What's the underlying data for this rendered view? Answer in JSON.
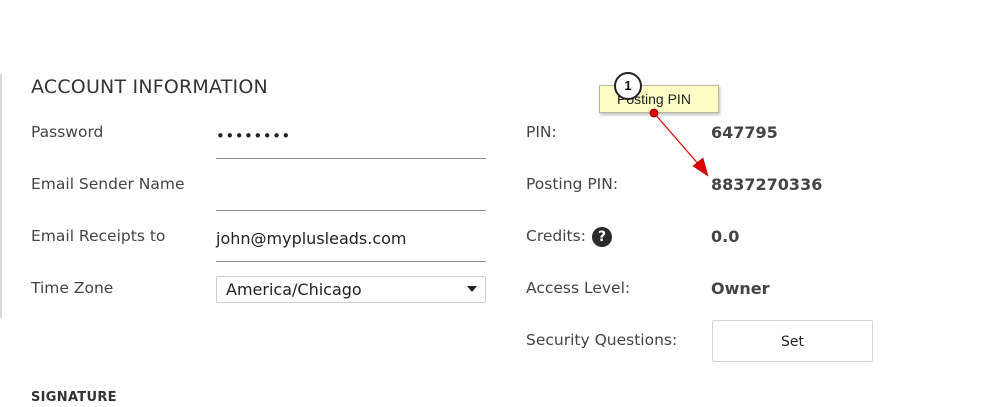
{
  "account": {
    "title": "ACCOUNT INFORMATION",
    "password_label": "Password",
    "password_value": "••••••••",
    "sender_name_label": "Email Sender Name",
    "sender_name_value": "",
    "receipts_label": "Email Receipts to",
    "receipts_value": "john@myplusleads.com",
    "timezone_label": "Time Zone",
    "timezone_value": "America/Chicago"
  },
  "details": {
    "pin_label": "PIN:",
    "pin_value": "647795",
    "posting_pin_label": "Posting PIN:",
    "posting_pin_value": "8837270336",
    "credits_label": "Credits:",
    "credits_help_icon": "?",
    "credits_value": "0.0",
    "access_label": "Access Level:",
    "access_value": "Owner",
    "security_label": "Security Questions:",
    "security_button": "Set"
  },
  "signature": {
    "title": "SIGNATURE"
  },
  "annotation": {
    "step_number": "1",
    "callout_text": "Posting PIN"
  },
  "icons": {
    "help": "question-circle-icon",
    "dropdown": "chevron-down-icon"
  },
  "colors": {
    "callout_background": "#fdfdc5",
    "arrow": "#e00000"
  }
}
